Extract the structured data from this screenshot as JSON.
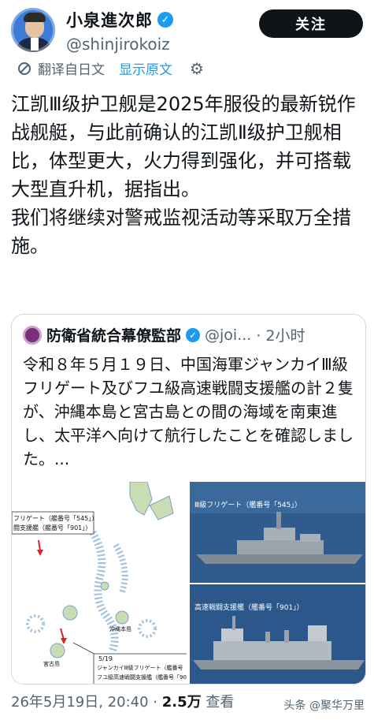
{
  "profile": {
    "display_name": "小泉進次郎",
    "handle": "@shinjirokoiz",
    "follow_label": "关注"
  },
  "translate": {
    "label": "翻译自日文",
    "show_original": "显示原文"
  },
  "tweet": {
    "text": "江凯Ⅲ级护卫舰是2025年服役的最新锐作战舰艇，与此前确认的江凯Ⅱ级护卫舰相比，体型更大，火力得到强化，并可搭载大型直升机，据指出。\n我们将继续对警戒监视活动等采取万全措施。"
  },
  "quote": {
    "name": "防衛省統合幕僚監部",
    "handle": "@joi...",
    "time": "· 2小时",
    "text": "令和８年５月１９日、中国海軍ジャンカイⅢ級フリゲート及びフユ級高速戦闘支援艦の計２隻が、沖縄本島と宮古島との間の海域を南東進し、太平洋へ向けて航行したことを確認しました。...",
    "media": {
      "map_label_1": "フリゲート（艦番号「545」）",
      "map_label_2": "闘支援艦（艦番号「901」）",
      "map_label_3": "5/19",
      "map_label_4": "ジャンカイⅢ級フリゲート（艦番号「54",
      "map_label_5": "フユ級高速戦闘支援艦（艦番号「901」）",
      "map_place_1": "沖縄本島",
      "map_place_2": "宮古島",
      "photo1_caption": "Ⅲ級フリゲート（艦番号「545」）",
      "photo2_caption": "高速戦闘支援艦（艦番号「901」）"
    }
  },
  "footer": {
    "date": "26年5月19日, 20:40 · ",
    "views": "2.5万",
    "views_label": " 查看"
  },
  "watermark": "头条 @聚华万里",
  "colors": {
    "accent": "#1d9bf0",
    "text": "#0f1419",
    "muted": "#536471",
    "border": "#cfd9de"
  }
}
